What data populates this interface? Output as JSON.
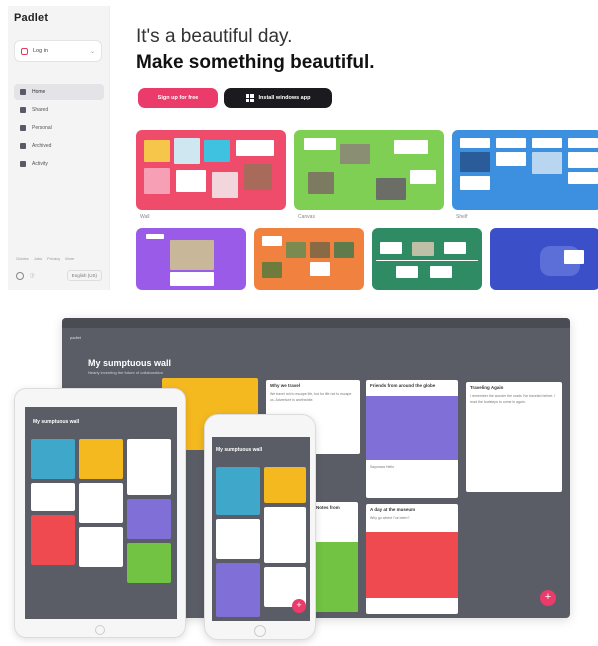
{
  "app": {
    "logo": "Padlet",
    "login_label": "Log in",
    "nav": [
      {
        "label": "Home",
        "icon": "home-icon"
      },
      {
        "label": "Shared",
        "icon": "people-icon"
      },
      {
        "label": "Personal",
        "icon": "person-icon"
      },
      {
        "label": "Archived",
        "icon": "archive-icon"
      },
      {
        "label": "Activity",
        "icon": "chart-icon"
      }
    ],
    "footer_links": [
      "Guides",
      "Jobs",
      "Privacy",
      "More"
    ],
    "language": "English (US)"
  },
  "hero": {
    "line1": "It's a beautiful day.",
    "line2": "Make something beautiful.",
    "signup_label": "Sign up for free",
    "install_label": "Install windows app"
  },
  "templates": [
    "Wall",
    "Canvas",
    "Shelf"
  ],
  "mockup": {
    "brand": "padlet",
    "wall_title": "My sumptuous wall",
    "wall_subtitle": "Nearly inventing the future of collaboration",
    "cards": [
      {
        "title": "Why we travel",
        "text": "We travel not to escape life, but for life not to escape us. Adventure is worthwhile."
      },
      {
        "title": "Friends from around the globe",
        "text": "Sayonara Hello"
      },
      {
        "title": "Traveling Again",
        "text": "I remember the wonder the roads I've traveled before. I read the footsteps to come in again."
      },
      {
        "title": "A day at the museum",
        "text": "Why go where I've been?"
      },
      {
        "title": "Notes from",
        "text": ""
      }
    ],
    "fab": "+"
  },
  "colors": {
    "accent": "#ea3b6a",
    "dark_button": "#1b1b1f",
    "wall_bg": "#5b5d66",
    "yellow": "#f5b920",
    "teal": "#3fa7c9",
    "purple": "#7f6fd6",
    "red": "#ef4a4f",
    "green": "#72c343"
  }
}
